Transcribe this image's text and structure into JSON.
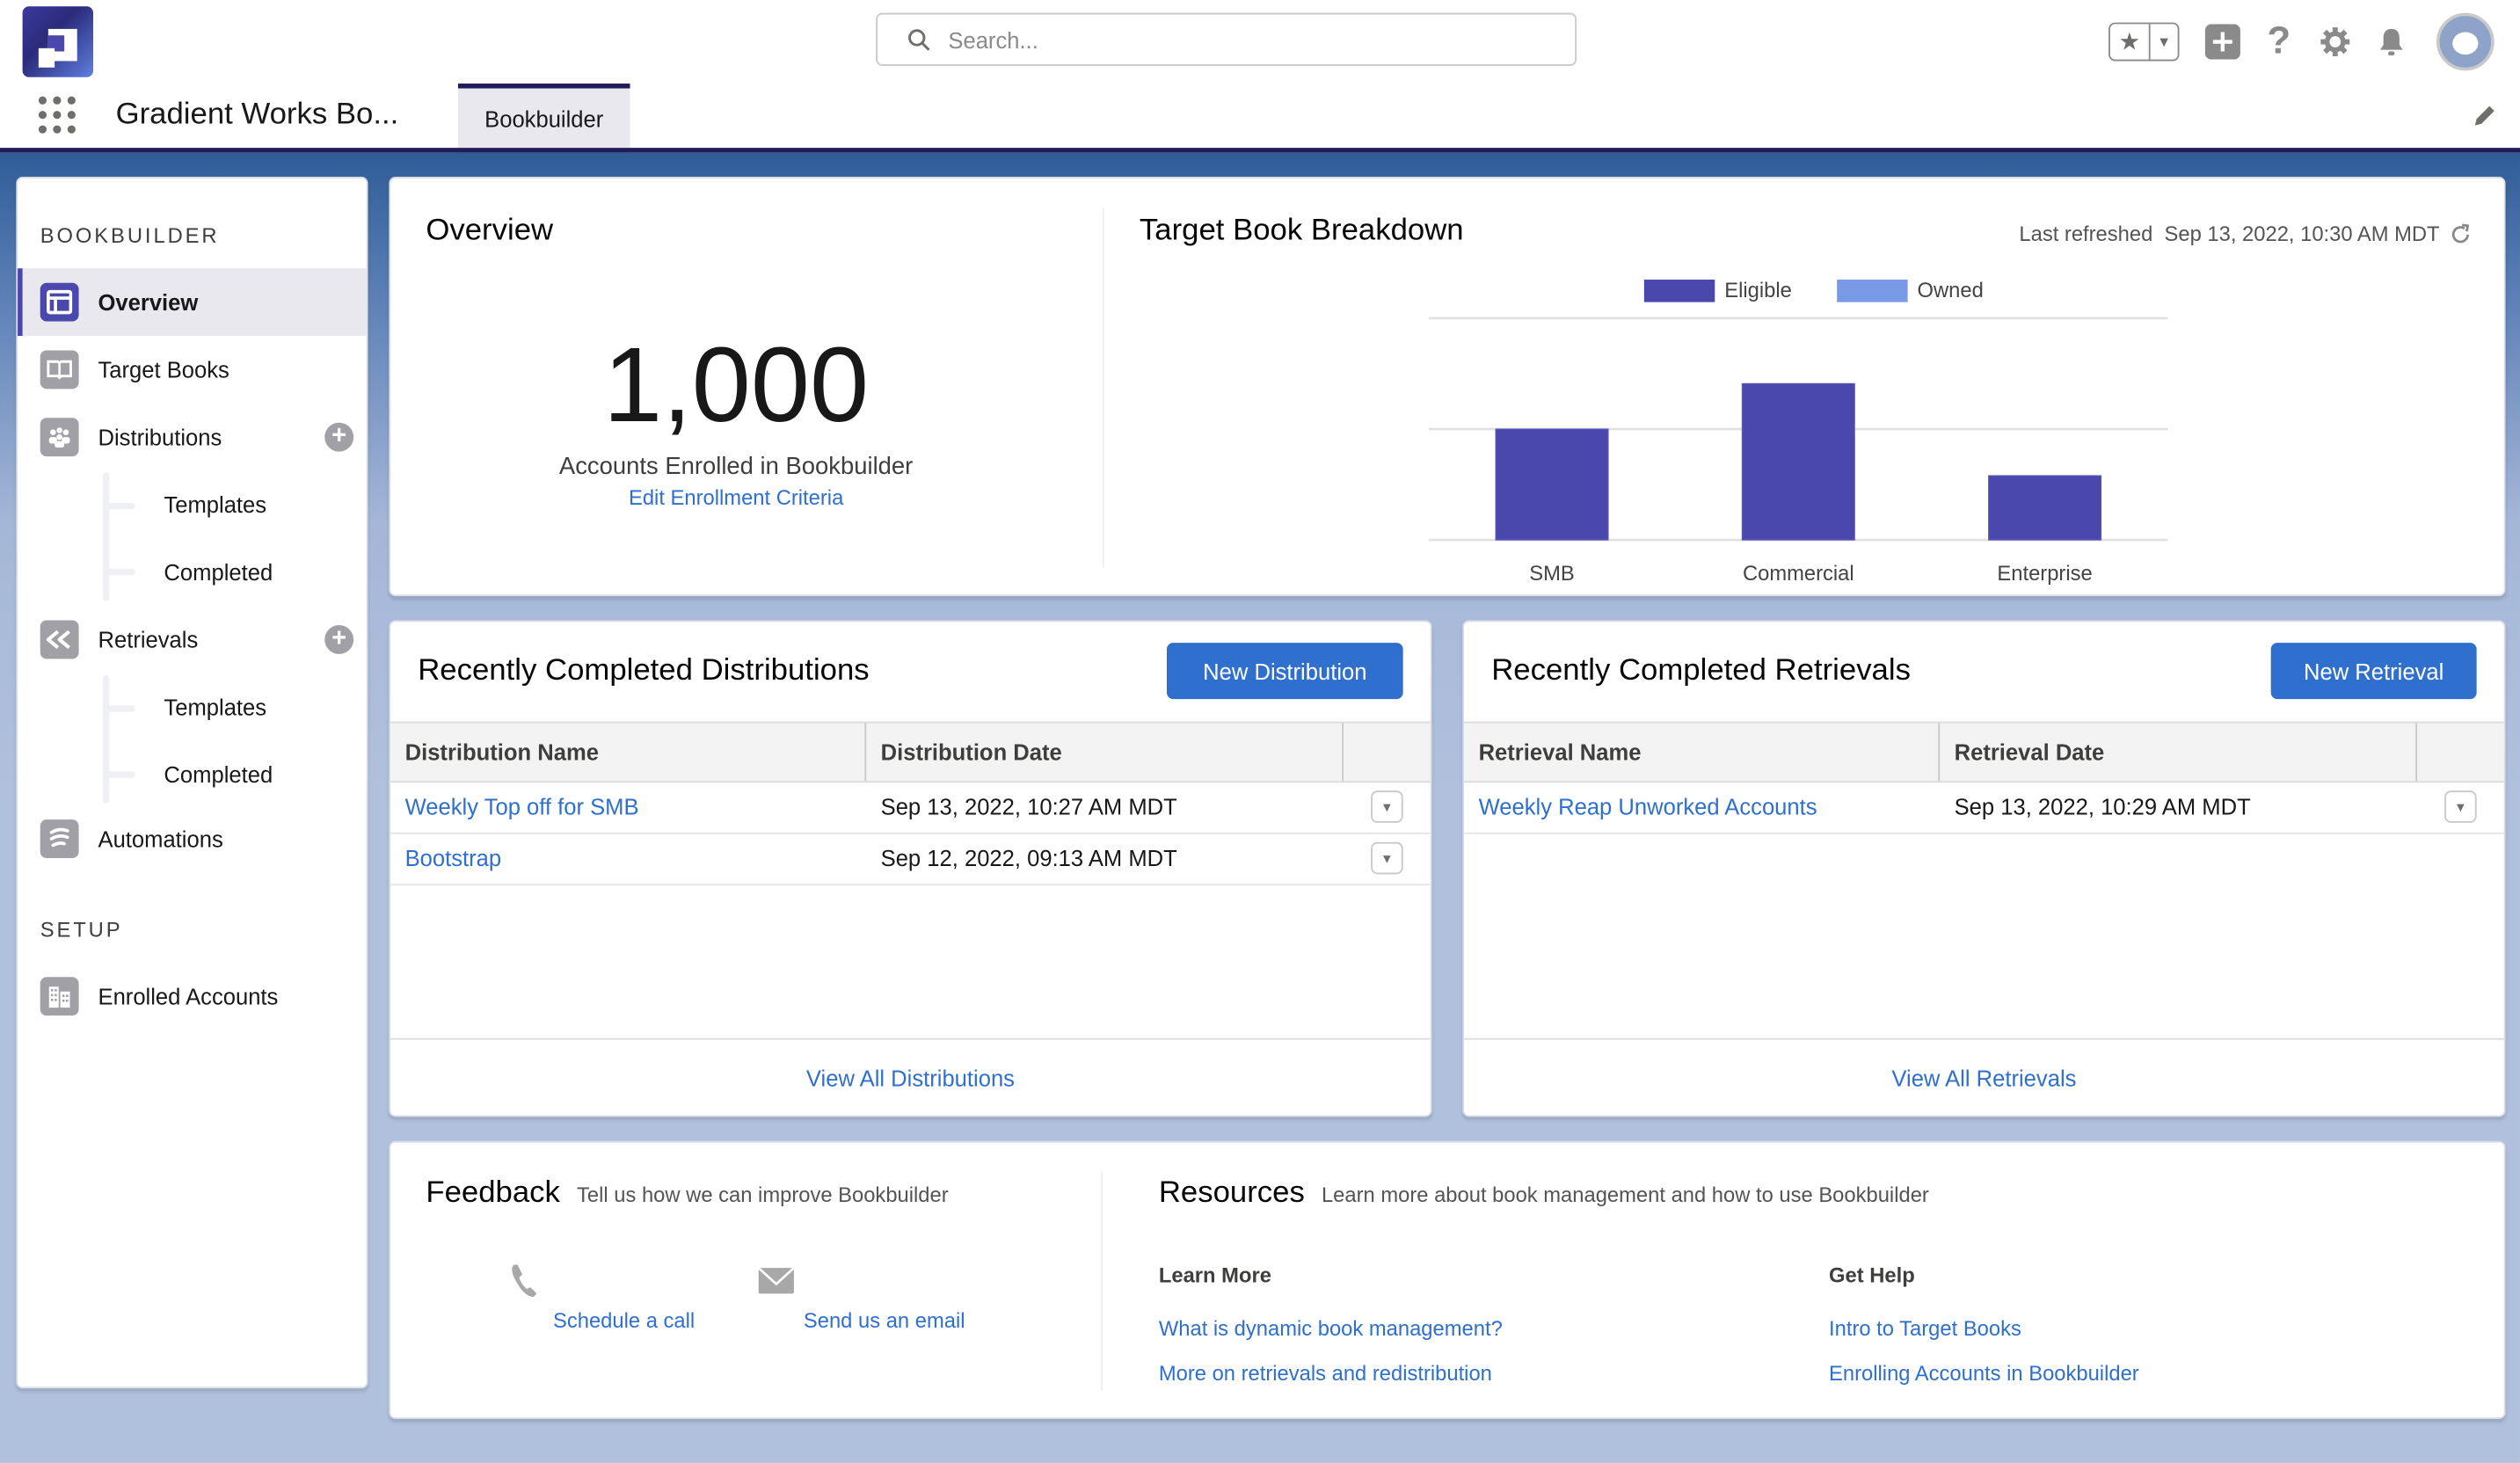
{
  "header": {
    "search_placeholder": "Search...",
    "app_name": "Gradient Works Bo...",
    "tabs": [
      {
        "label": "Bookbuilder",
        "active": true
      }
    ],
    "icons": [
      "app-logo",
      "search-icon",
      "favorites-star-icon",
      "favorites-dropdown-icon",
      "global-add-icon",
      "help-icon",
      "setup-gear-icon",
      "notifications-bell-icon",
      "user-avatar",
      "app-launcher-icon",
      "edit-nav-pencil-icon"
    ]
  },
  "sidebar": {
    "section1": "BOOKBUILDER",
    "items": [
      {
        "label": "Overview",
        "icon": "overview-icon",
        "active": true
      },
      {
        "label": "Target Books",
        "icon": "book-icon"
      },
      {
        "label": "Distributions",
        "icon": "group-icon",
        "has_add": true,
        "children": [
          {
            "label": "Templates"
          },
          {
            "label": "Completed"
          }
        ]
      },
      {
        "label": "Retrievals",
        "icon": "retrieve-arrow-icon",
        "has_add": true,
        "children": [
          {
            "label": "Templates"
          },
          {
            "label": "Completed"
          }
        ]
      },
      {
        "label": "Automations",
        "icon": "flow-icon"
      }
    ],
    "section2": "SETUP",
    "setup_items": [
      {
        "label": "Enrolled Accounts",
        "icon": "building-icon"
      }
    ]
  },
  "overview": {
    "title": "Overview",
    "count": "1,000",
    "count_label": "Accounts Enrolled in Bookbuilder",
    "edit_link": "Edit Enrollment Criteria"
  },
  "breakdown": {
    "title": "Target Book Breakdown",
    "refreshed_label": "Last refreshed",
    "refreshed_value": "Sep 13, 2022, 10:30 AM MDT"
  },
  "chart_data": {
    "type": "bar",
    "stacked": true,
    "title": "Target Book Breakdown",
    "categories": [
      "SMB",
      "Commercial",
      "Enterprise"
    ],
    "series": [
      {
        "name": "Eligible",
        "color": "#4a47ad",
        "values": [
          0.5,
          0.705,
          0.29
        ]
      },
      {
        "name": "Owned",
        "color": "#7899e6",
        "values": [
          0,
          0,
          0
        ]
      }
    ],
    "value_note": "relative to chart maximum (no axis tick labels shown)",
    "ylim": [
      0,
      1
    ],
    "gridlines": 3,
    "legend": "top",
    "xlabel": "",
    "ylabel": ""
  },
  "distributions": {
    "title": "Recently Completed Distributions",
    "new_button": "New Distribution",
    "columns": [
      "Distribution Name",
      "Distribution Date"
    ],
    "rows": [
      {
        "name": "Weekly Top off for SMB",
        "date": "Sep 13, 2022, 10:27 AM MDT"
      },
      {
        "name": "Bootstrap",
        "date": "Sep 12, 2022, 09:13 AM MDT"
      }
    ],
    "view_all": "View All Distributions"
  },
  "retrievals": {
    "title": "Recently Completed Retrievals",
    "new_button": "New Retrieval",
    "columns": [
      "Retrieval Name",
      "Retrieval Date"
    ],
    "rows": [
      {
        "name": "Weekly Reap Unworked Accounts",
        "date": "Sep 13, 2022, 10:29 AM MDT"
      }
    ],
    "view_all": "View All Retrievals"
  },
  "feedback": {
    "title": "Feedback",
    "subtitle": "Tell us how we can improve Bookbuilder",
    "actions": [
      {
        "label": "Schedule a call",
        "icon": "phone-icon"
      },
      {
        "label": "Send us an email",
        "icon": "email-icon"
      }
    ]
  },
  "resources": {
    "title": "Resources",
    "subtitle": "Learn more about book management and how to use Bookbuilder",
    "learn_more": {
      "heading": "Learn More",
      "links": [
        "What is dynamic book management?",
        "More on retrievals and redistribution"
      ]
    },
    "get_help": {
      "heading": "Get Help",
      "links": [
        "Intro to Target Books",
        "Enrolling Accounts in Bookbuilder"
      ]
    }
  }
}
